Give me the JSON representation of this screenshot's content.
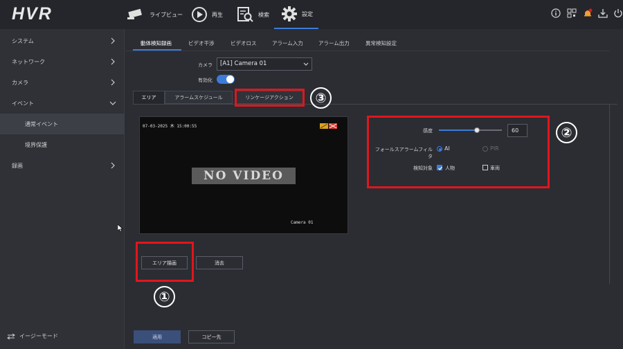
{
  "app": {
    "logo": "HVR"
  },
  "nav": [
    {
      "label": "ライブビュー",
      "icon": "camera-icon"
    },
    {
      "label": "再生",
      "icon": "play-icon"
    },
    {
      "label": "検索",
      "icon": "search-doc-icon"
    },
    {
      "label": "設定",
      "icon": "gear-icon"
    }
  ],
  "sidebar": {
    "items": [
      {
        "label": "システム"
      },
      {
        "label": "ネットワーク"
      },
      {
        "label": "カメラ"
      },
      {
        "label": "イベント"
      },
      {
        "label": "通常イベント"
      },
      {
        "label": "境界保護"
      },
      {
        "label": "録画"
      }
    ],
    "easy_mode": "イージーモード"
  },
  "tabs": [
    "動体検知録画",
    "ビデオ干渉",
    "ビデオロス",
    "アラーム入力",
    "アラーム出力",
    "異常検知設定"
  ],
  "form": {
    "camera_label": "カメラ",
    "camera_value": "[A1] Camera 01",
    "enable_label": "有効化",
    "enabled": true
  },
  "subtabs": [
    "エリア",
    "アラームスケジュール",
    "リンケージアクション"
  ],
  "video": {
    "timestamp": "07-03-2025 木 15:00:55",
    "no_video": "NO VIDEO",
    "camera_name": "Camera 01"
  },
  "settings": {
    "sensitivity_label": "感度",
    "sensitivity_value": "60",
    "sensitivity_fraction": 0.6,
    "false_alarm_label": "フォールスアラームフィルタ",
    "option_ai": "AI",
    "option_pir": "PIR",
    "target_label": "検知対象",
    "target_person": "人物",
    "target_vehicle": "車両"
  },
  "buttons": {
    "draw_area": "エリア描画",
    "clear": "消去",
    "apply": "適用",
    "copy_to": "コピー先"
  },
  "annotations": [
    "①",
    "②",
    "③"
  ],
  "colors": {
    "accent": "#3d7bd9",
    "highlight": "#e0161c"
  }
}
